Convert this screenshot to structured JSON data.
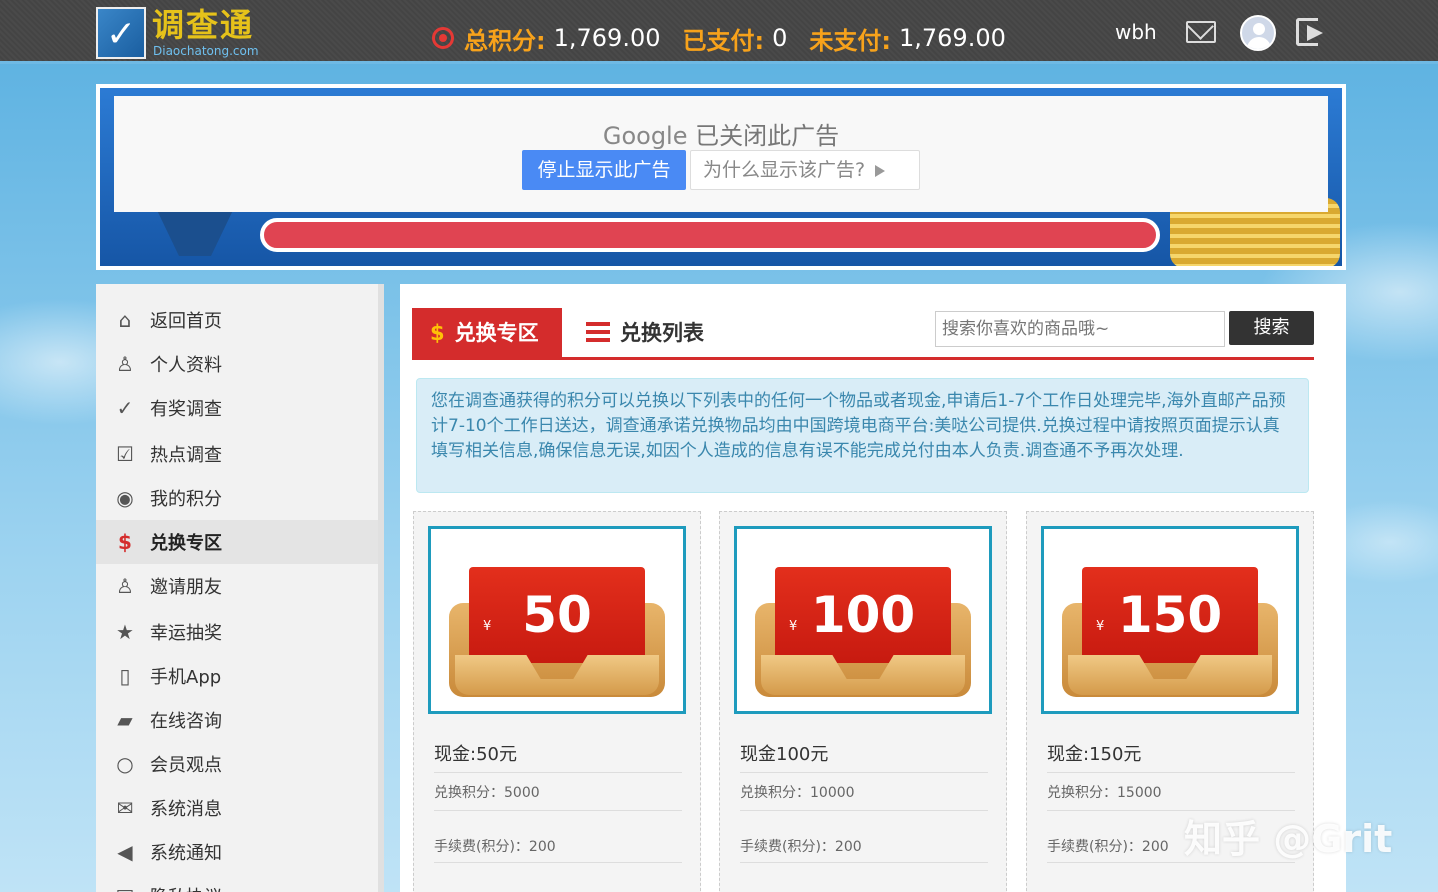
{
  "header": {
    "logo_name": "调查通",
    "logo_sub": "Diaochatong.com",
    "total_label": "总积分:",
    "total_value": "1,769.00",
    "paid_label": "已支付:",
    "paid_value": "0",
    "unpaid_label": "未支付:",
    "unpaid_value": "1,769.00",
    "username": "wbh"
  },
  "ad": {
    "title_brand": "Google",
    "title_text": "已关闭此广告",
    "stop_label": "停止显示此广告",
    "why_label": "为什么显示该广告?"
  },
  "sidebar": {
    "items": [
      {
        "label": "返回首页",
        "icon": "home-icon"
      },
      {
        "label": "个人资料",
        "icon": "user-icon"
      },
      {
        "label": "有奖调查",
        "icon": "check-circle-icon"
      },
      {
        "label": "热点调查",
        "icon": "checkbox-icon"
      },
      {
        "label": "我的积分",
        "icon": "points-icon"
      },
      {
        "label": "兑换专区",
        "icon": "dollar-icon"
      },
      {
        "label": "邀请朋友",
        "icon": "add-user-icon"
      },
      {
        "label": "幸运抽奖",
        "icon": "star-icon"
      },
      {
        "label": "手机App",
        "icon": "phone-icon"
      },
      {
        "label": "在线咨询",
        "icon": "chat-icon"
      },
      {
        "label": "会员观点",
        "icon": "comment-icon"
      },
      {
        "label": "系统消息",
        "icon": "envelope-icon"
      },
      {
        "label": "系统通知",
        "icon": "megaphone-icon"
      },
      {
        "label": "隐私协议",
        "icon": "document-icon"
      }
    ],
    "active_index": 5
  },
  "main": {
    "tab_active": "兑换专区",
    "tab_list": "兑换列表",
    "search_placeholder": "搜索你喜欢的商品哦~",
    "search_button": "搜索",
    "notice": "您在调查通获得的积分可以兑换以下列表中的任何一个物品或者现金,申请后1-7个工作日处理完毕,海外直邮产品预计7-10个工作日送达，调查通承诺兑换物品均由中国跨境电商平台:美哒公司提供.兑换过程中请按照页面提示认真填写相关信息,确保信息无误,如因个人造成的信息有误不能完成兑付由本人负责.调查通不予再次处理."
  },
  "products": [
    {
      "amount": "50",
      "yen": "¥",
      "name": "现金:50元",
      "points": "兑换积分：5000",
      "fee": "手续费(积分)：200"
    },
    {
      "amount": "100",
      "yen": "¥",
      "name": "现金100元",
      "points": "兑换积分：10000",
      "fee": "手续费(积分)：200"
    },
    {
      "amount": "150",
      "yen": "¥",
      "name": "现金:150元",
      "points": "兑换积分：15000",
      "fee": "手续费(积分)：200"
    }
  ],
  "watermark": "知乎 @Grit",
  "colors": {
    "accent": "#d42c2c",
    "header_bg": "#444444",
    "points_label": "#f7a21b",
    "notice_text": "#3a87ad"
  }
}
